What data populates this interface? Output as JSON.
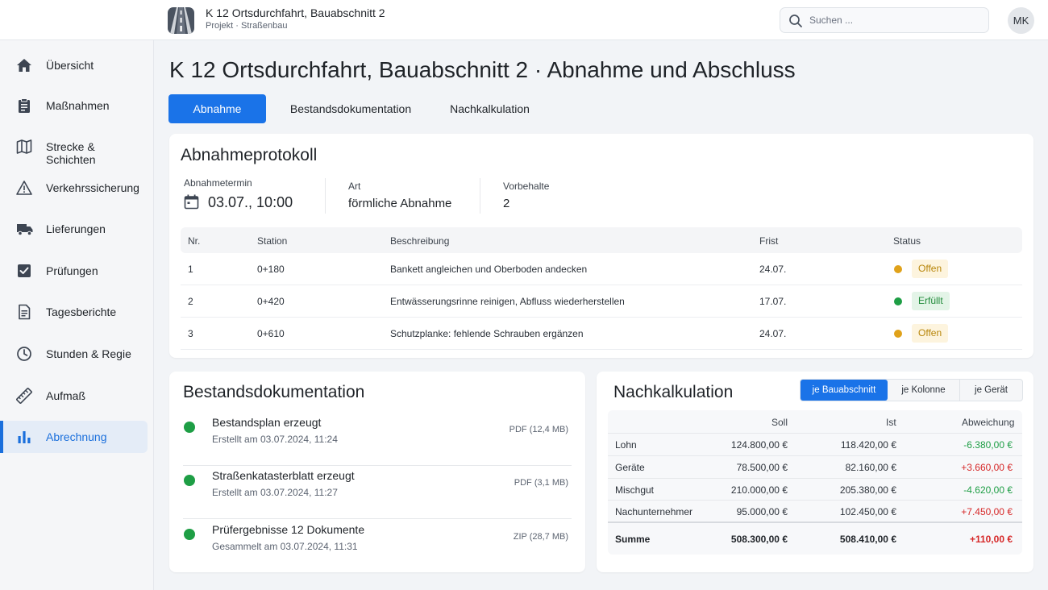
{
  "header": {
    "project_title": "K 12 Ortsdurchfahrt, Bauabschnitt 2",
    "project_subtitle": "Projekt · Straßenbau",
    "search_placeholder": "Suchen ...",
    "avatar_initials": "MK",
    "logo_icon": "road-icon"
  },
  "sidebar": {
    "items": [
      {
        "label": "Übersicht",
        "icon": "home-icon"
      },
      {
        "label": "Maßnahmen",
        "icon": "clipboard-icon"
      },
      {
        "label": "Strecke & Schichten",
        "icon": "map-icon"
      },
      {
        "label": "Verkehrssicherung",
        "icon": "warning-icon"
      },
      {
        "label": "Lieferungen",
        "icon": "truck-icon"
      },
      {
        "label": "Prüfungen",
        "icon": "checkbox-icon"
      },
      {
        "label": "Tagesberichte",
        "icon": "document-icon"
      },
      {
        "label": "Stunden & Regie",
        "icon": "clock-icon"
      },
      {
        "label": "Aufmaß",
        "icon": "ruler-icon"
      },
      {
        "label": "Abrechnung",
        "icon": "bar-chart-icon",
        "active": true
      }
    ]
  },
  "page": {
    "title": "K 12 Ortsdurchfahrt, Bauabschnitt 2 · Abnahme und Abschluss",
    "tabs": [
      {
        "label": "Abnahme",
        "active": true
      },
      {
        "label": "Bestandsdokumentation"
      },
      {
        "label": "Nachkalkulation"
      }
    ]
  },
  "abnahme": {
    "title": "Abnahmeprotokoll",
    "termin_label": "Abnahmetermin",
    "termin_value": "03.07., 10:00",
    "art_label": "Art",
    "art_value": "förmliche Abnahme",
    "vorbehalte_label": "Vorbehalte",
    "vorbehalte_value": "2",
    "columns": [
      "Nr.",
      "Station",
      "Beschreibung",
      "Frist",
      "Status"
    ],
    "rows": [
      {
        "nr": "1",
        "station": "0+180",
        "beschreibung": "Bankett angleichen und Oberboden andecken",
        "frist": "24.07.",
        "status": "Offen",
        "status_color": "#e0a21a"
      },
      {
        "nr": "2",
        "station": "0+420",
        "beschreibung": "Entwässerungsrinne reinigen, Abfluss wiederherstellen",
        "frist": "17.07.",
        "status": "Erfüllt",
        "status_color": "#1e9e45"
      },
      {
        "nr": "3",
        "station": "0+610",
        "beschreibung": "Schutzplanke: fehlende Schrauben ergänzen",
        "frist": "24.07.",
        "status": "Offen",
        "status_color": "#e0a21a"
      }
    ]
  },
  "bestand": {
    "title": "Bestandsdokumentation",
    "items": [
      {
        "name": "Bestandsplan erzeugt",
        "date": "Erstellt am 03.07.2024, 11:24",
        "size": "PDF (12,4 MB)"
      },
      {
        "name": "Straßenkatasterblatt erzeugt",
        "date": "Erstellt am 03.07.2024, 11:27",
        "size": "PDF (3,1 MB)"
      },
      {
        "name": "Prüfergebnisse 12 Dokumente",
        "date": "Gesammelt am 03.07.2024, 11:31",
        "size": "ZIP (28,7 MB)"
      }
    ]
  },
  "nachkalkulation": {
    "title": "Nachkalkulation",
    "segments": [
      "je Bauabschnitt",
      "je Kolonne",
      "je Gerät"
    ],
    "columns": [
      "",
      "Soll",
      "Ist",
      "Abweichung"
    ],
    "rows": [
      {
        "label": "Lohn",
        "soll": "124.800,00 €",
        "ist": "118.420,00 €",
        "abw": "-6.380,00 €"
      },
      {
        "label": "Geräte",
        "soll": "78.500,00 €",
        "ist": "82.160,00 €",
        "abw": "+3.660,00 €"
      },
      {
        "label": "Mischgut",
        "soll": "210.000,00 €",
        "ist": "205.380,00 €",
        "abw": "-4.620,00 €"
      },
      {
        "label": "Nachunternehmer",
        "soll": "95.000,00 €",
        "ist": "102.450,00 €",
        "abw": "+7.450,00 €"
      }
    ],
    "sum": {
      "label": "Summe",
      "soll": "508.300,00 €",
      "ist": "508.410,00 €",
      "abw": "+110,00 €"
    }
  },
  "colors": {
    "accent": "#1a73e8",
    "positive": "#1e9e45",
    "negative": "#d62828",
    "warning": "#e0a21a"
  }
}
